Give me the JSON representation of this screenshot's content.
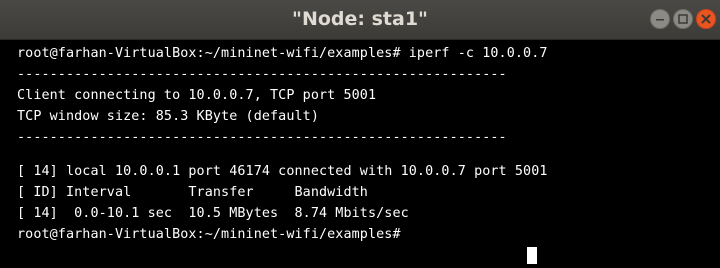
{
  "window": {
    "title": "\"Node: sta1\""
  },
  "terminal": {
    "lines": [
      "root@farhan-VirtualBox:~/mininet-wifi/examples# iperf -c 10.0.0.7",
      "------------------------------------------------------------",
      "Client connecting to 10.0.0.7, TCP port 5001",
      "TCP window size: 85.3 KByte (default)",
      "------------------------------------------------------------",
      "[ 14] local 10.0.0.1 port 46174 connected with 10.0.0.7 port 5001",
      "[ ID] Interval       Transfer     Bandwidth",
      "[ 14]  0.0-10.1 sec  10.5 MBytes  8.74 Mbits/sec",
      "root@farhan-VirtualBox:~/mininet-wifi/examples# "
    ]
  },
  "colors": {
    "background": "#000000",
    "foreground": "#ffffff",
    "titlebar": "#3c3b37",
    "close_button": "#e95420"
  },
  "icons": {
    "minimize": "minimize-icon",
    "maximize": "maximize-icon",
    "close": "close-icon"
  }
}
